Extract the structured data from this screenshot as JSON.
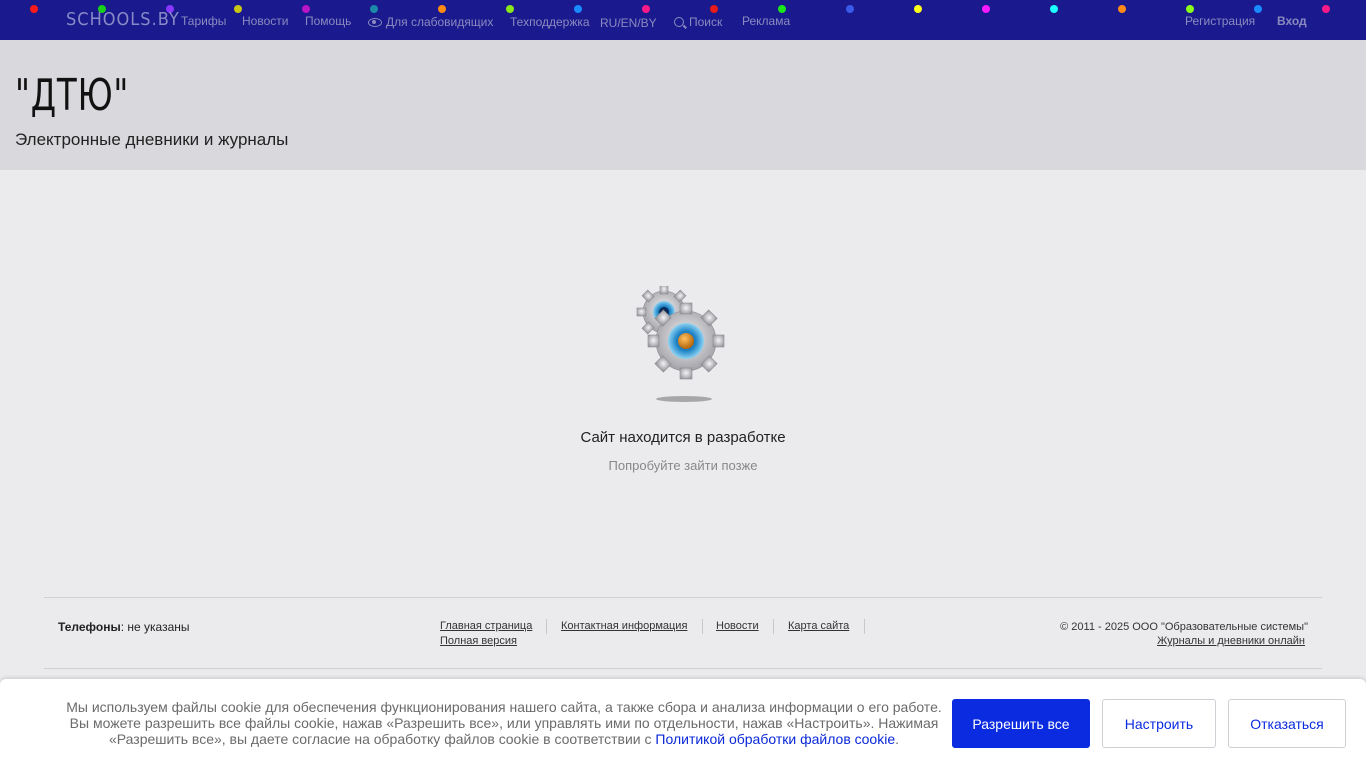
{
  "topbar": {
    "logo": "SCHOOLS.BY",
    "nav": {
      "tariffs": "Тарифы",
      "news": "Новости",
      "help": "Помощь",
      "low_vision": "Для слабовидящих",
      "support": "Техподдержка",
      "languages": "RU/EN/BY",
      "search": "Поиск",
      "ads": "Реклама",
      "register": "Регистрация",
      "login": "Вход"
    },
    "dot_colors": [
      "#ff1a1a",
      "#19d11b",
      "#8a37ff",
      "#c8c814",
      "#b814c8",
      "#1a8aa8",
      "#ff8a14",
      "#8ae81a",
      "#1a8aff",
      "#ff1a8a",
      "#e81a1a",
      "#1ae81a",
      "#3a5ae8",
      "#ffff1a",
      "#ff1aff",
      "#1affff",
      "#ff8a1a",
      "#8aff1a",
      "#1a8aff",
      "#ff1a8a"
    ]
  },
  "header": {
    "title": "\"ДТЮ\"",
    "subtitle": "Электронные дневники и журналы"
  },
  "main": {
    "status_title": "Сайт находится в разработке",
    "status_hint": "Попробуйте зайти позже"
  },
  "footer": {
    "phones_label": "Телефоны",
    "phones_value": ": не указаны",
    "links": {
      "home": "Главная страница",
      "contacts": "Контактная информация",
      "news": "Новости",
      "sitemap": "Карта сайта",
      "full_version": "Полная версия"
    },
    "copyright": "© 2011 - 2025 ООО \"Образовательные системы\"",
    "tagline": "Журналы и дневники онлайн"
  },
  "cookie": {
    "text": "Мы используем файлы cookie для обеспечения функционирования нашего сайта, а также сбора и анализа информации о его работе. Вы можете разрешить все файлы cookie, нажав «Разрешить все», или управлять ими по отдельности, нажав «Настроить». Нажимая «Разрешить все», вы даете согласие на обработку файлов cookie в соответствии с ",
    "policy_link": "Политикой обработки файлов cookie",
    "end": ".",
    "allow_all": "Разрешить все",
    "configure": "Настроить",
    "reject": "Отказаться"
  }
}
